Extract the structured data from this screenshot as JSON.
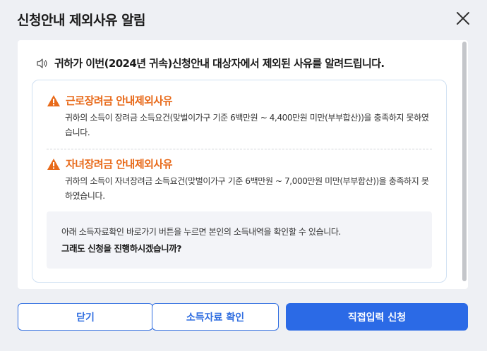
{
  "modal": {
    "title": "신청안내 제외사유 알림"
  },
  "notice": {
    "text": "귀하가 이번(2024년 귀속)신청안내 대상자에서 제외된 사유를 알려드립니다."
  },
  "reasons": [
    {
      "title": "근로장려금 안내제외사유",
      "description": "귀하의 소득이 장려금 소득요건(맞벌이가구 기준 6백만원 ~ 4,400만원 미만(부부합산))을 충족하지 못하였습니다."
    },
    {
      "title": "자녀장려금 안내제외사유",
      "description": "귀하의 소득이 자녀장려금 소득요건(맞벌이가구 기준 6백만원 ~ 7,000만원 미만(부부합산))을 충족하지 못하였습니다."
    }
  ],
  "info": {
    "text": "아래 소득자료확인 바로가기 버튼을 누르면 본인의 소득내역을 확인할 수 있습니다.",
    "question": "그래도 신청을 진행하시겠습니까?"
  },
  "buttons": {
    "close_label": "닫기",
    "check_income_label": "소득자료 확인",
    "direct_apply_label": "직접입력 신청"
  },
  "colors": {
    "accent": "#2b6ae6",
    "warning": "#e86a1a"
  },
  "icons": {
    "close": "close-icon",
    "speaker": "speaker-icon",
    "warning": "warning-icon"
  }
}
